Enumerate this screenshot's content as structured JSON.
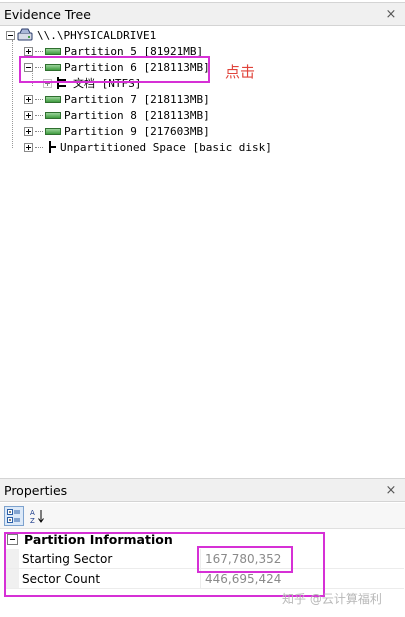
{
  "evidence_tree": {
    "title": "Evidence Tree",
    "close_glyph": "×",
    "root": {
      "label": "\\\\.\\PHYSICALDRIVE1",
      "icon": "physical-drive-icon"
    },
    "items": [
      {
        "label": "Partition 5 [81921MB]",
        "expanded": false,
        "icon": "partition-disk-icon"
      },
      {
        "label": "Partition 6 [218113MB]",
        "expanded": true,
        "icon": "partition-disk-icon"
      },
      {
        "label": "文档 [NTFS]",
        "expanded": false,
        "icon": "filesystem-icon"
      },
      {
        "label": "Partition 7 [218113MB]",
        "expanded": false,
        "icon": "partition-disk-icon"
      },
      {
        "label": "Partition 8 [218113MB]",
        "expanded": false,
        "icon": "partition-disk-icon"
      },
      {
        "label": "Partition 9 [217603MB]",
        "expanded": false,
        "icon": "partition-disk-icon"
      },
      {
        "label": "Unpartitioned Space [basic disk]",
        "expanded": false,
        "icon": "unpartitioned-space-icon"
      }
    ]
  },
  "annotation": {
    "text": "点击",
    "color": "#e0433a",
    "box_color": "#d630d6"
  },
  "properties": {
    "title": "Properties",
    "close_glyph": "×",
    "toolbar": {
      "categorized_icon": "categorized-view-icon",
      "alphabetical_icon": "sort-az-icon"
    },
    "category": "Partition Information",
    "rows": [
      {
        "name": "Starting Sector",
        "value": "167,780,352"
      },
      {
        "name": "Sector Count",
        "value": "446,695,424"
      }
    ]
  },
  "watermark": "知乎 @云计算福利"
}
